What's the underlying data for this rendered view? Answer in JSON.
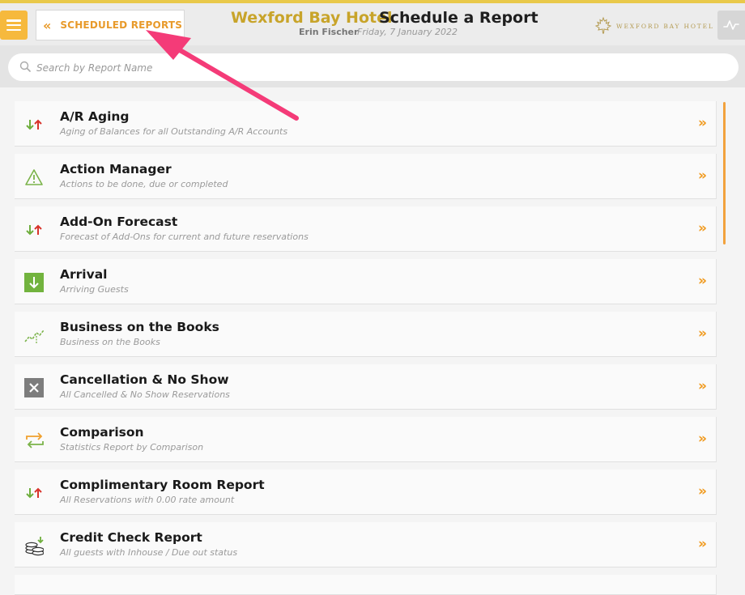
{
  "header": {
    "back_label": "SCHEDULED REPORTS",
    "hotel_name": "Wexford Bay Hotel",
    "page_title": "Schedule a Report",
    "user_name": "Erin Fischer",
    "date": "Friday, 7 January 2022",
    "logo_text": "WEXFORD BAY HOTEL"
  },
  "search": {
    "placeholder": "Search by Report Name",
    "value": ""
  },
  "colors": {
    "accent": "#f09a1e",
    "hotel_gold": "#c8a42a",
    "menu_button": "#f6b93d",
    "annotation_arrow": "#f43b78"
  },
  "reports": [
    {
      "title": "A/R Aging",
      "subtitle": "Aging of Balances for all Outstanding A/R Accounts",
      "icon": "up-down-arrows-icon"
    },
    {
      "title": "Action Manager",
      "subtitle": "Actions to be done, due or completed",
      "icon": "warning-icon"
    },
    {
      "title": "Add-On Forecast",
      "subtitle": "Forecast of Add-Ons for current and future reservations",
      "icon": "up-down-arrows-icon"
    },
    {
      "title": "Arrival",
      "subtitle": "Arriving Guests",
      "icon": "arrival-down-arrow-icon"
    },
    {
      "title": "Business on the Books",
      "subtitle": "Business on the Books",
      "icon": "trend-line-icon"
    },
    {
      "title": "Cancellation & No Show",
      "subtitle": "All Cancelled & No Show Reservations",
      "icon": "cancel-x-icon"
    },
    {
      "title": "Comparison",
      "subtitle": "Statistics Report by Comparison",
      "icon": "compare-arrows-icon"
    },
    {
      "title": "Complimentary Room Report",
      "subtitle": "All Reservations with 0.00 rate amount",
      "icon": "up-down-arrows-icon"
    },
    {
      "title": "Credit Check Report",
      "subtitle": "All guests with Inhouse / Due out status",
      "icon": "coins-icon"
    }
  ]
}
